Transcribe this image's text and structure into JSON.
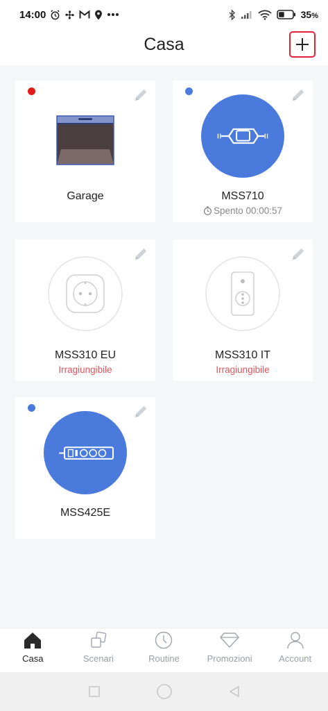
{
  "status_bar": {
    "time": "14:00",
    "battery": "35",
    "battery_unit": "%"
  },
  "header": {
    "title": "Casa"
  },
  "colors": {
    "online_dot": "#4a7bdc",
    "offline_dot": "#e21b1b",
    "add_button_border": "#e0243a",
    "unreachable_text": "#e0545a"
  },
  "devices": [
    {
      "name": "Garage",
      "status": "",
      "dot": "red",
      "icon": "garage-door-icon"
    },
    {
      "name": "MSS710",
      "status": "Spento 00:00:57",
      "dot": "blue",
      "icon": "inline-switch-icon",
      "status_icon": "timer-icon"
    },
    {
      "name": "MSS310 EU",
      "status": "Irragiungibile",
      "dot": "none",
      "icon": "eu-plug-icon"
    },
    {
      "name": "MSS310 IT",
      "status": "Irragiungibile",
      "dot": "none",
      "icon": "it-plug-icon"
    },
    {
      "name": "MSS425E",
      "status": "",
      "dot": "blue",
      "icon": "power-strip-icon"
    }
  ],
  "nav": {
    "items": [
      {
        "label": "Casa",
        "icon": "home-icon",
        "active": true
      },
      {
        "label": "Scenari",
        "icon": "scenes-icon",
        "active": false
      },
      {
        "label": "Routine",
        "icon": "clock-icon",
        "active": false
      },
      {
        "label": "Promozioni",
        "icon": "diamond-icon",
        "active": false
      },
      {
        "label": "Account",
        "icon": "user-icon",
        "active": false
      }
    ]
  }
}
